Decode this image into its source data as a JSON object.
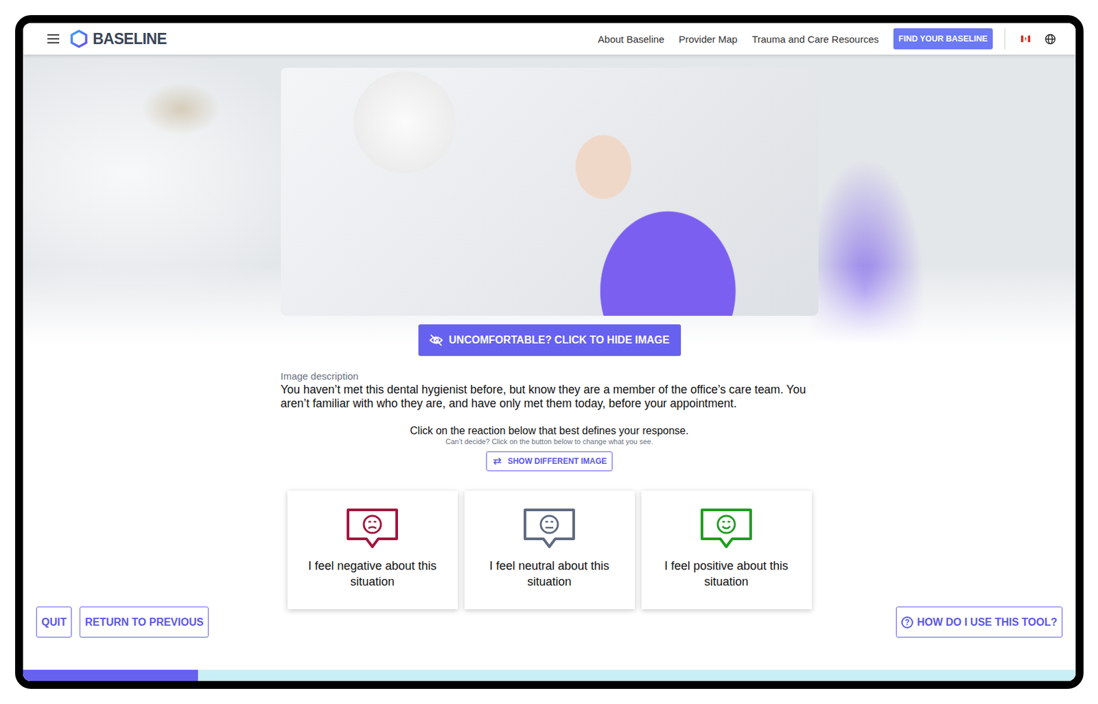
{
  "header": {
    "logo": "BASELINE",
    "nav": [
      {
        "label": "About Baseline"
      },
      {
        "label": "Provider Map"
      },
      {
        "label": "Trauma and Care Resources"
      }
    ],
    "cta": "FIND YOUR BASELINE"
  },
  "image": {
    "hide_button": "UNCOMFORTABLE? CLICK TO HIDE IMAGE"
  },
  "description": {
    "label": "Image description",
    "text": "You haven’t met this dental hygienist before, but know they are a member of the office’s care team. You aren’t familiar with who they are, and have only met them today, before your appointment."
  },
  "prompt": {
    "text": "Click on the reaction below that best defines your response.",
    "hint": "Can’t decide? Click on the button below to change what you see.",
    "button": "SHOW DIFFERENT IMAGE"
  },
  "reactions": [
    {
      "label": "I feel negative about this situation",
      "kind": "negative",
      "color": "#a3153d",
      "selected": false
    },
    {
      "label": "I feel neutral about this situation",
      "kind": "neutral",
      "color": "#5f6b80",
      "selected": false
    },
    {
      "label": "I feel positive about this situation",
      "kind": "positive",
      "color": "#1e9e1e",
      "selected": false
    }
  ],
  "footer": {
    "left_buttons": [
      "QUIT",
      "RETURN TO PREVIOUS"
    ],
    "help": {
      "icon": "?",
      "label": "HOW DO I USE THIS TOOL?"
    }
  },
  "progress": {
    "level": 0.166
  }
}
